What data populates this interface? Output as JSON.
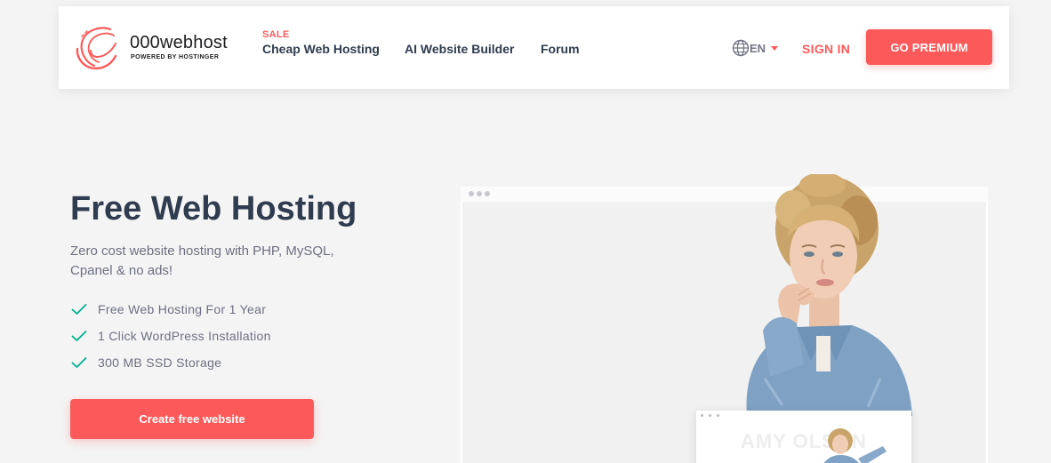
{
  "brand": {
    "name": "000webhost",
    "tagline": "POWERED BY HOSTINGER"
  },
  "nav": {
    "sale_tag": "SALE",
    "items": [
      {
        "label": "Cheap Web Hosting"
      },
      {
        "label": "AI Website Builder"
      },
      {
        "label": "Forum"
      }
    ],
    "language": "EN",
    "sign_in": "SIGN IN",
    "premium": "GO PREMIUM"
  },
  "hero": {
    "title": "Free Web Hosting",
    "subtitle": "Zero cost website hosting with PHP, MySQL, Cpanel & no ads!",
    "features": [
      "Free Web Hosting For 1 Year",
      "1 Click WordPress Installation",
      "300 MB SSD Storage"
    ],
    "cta": "Create free website"
  },
  "preview": {
    "mini_title": "AMY OLSON"
  },
  "colors": {
    "accent": "#fc5a5a",
    "heading": "#2f3c4f",
    "check": "#00b090",
    "background": "#f4f4f4"
  },
  "icons": {
    "logo": "swirl-logo-icon",
    "language": "globe-icon",
    "caret": "caret-down-icon",
    "feature": "check-icon"
  }
}
